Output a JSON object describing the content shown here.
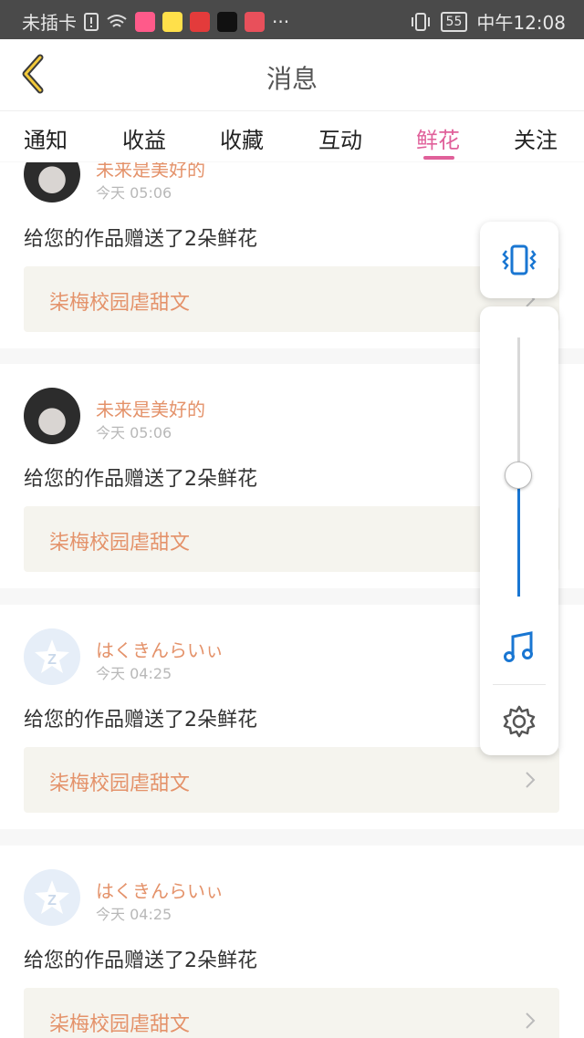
{
  "status_bar": {
    "carrier": "未插卡",
    "battery": "55",
    "time": "中午12:08",
    "more": "···",
    "icons": [
      "sim-alert-icon",
      "wifi-icon",
      "app-icon-1",
      "app-icon-2",
      "app-icon-3",
      "tiktok-icon",
      "reader-icon",
      "vibrate-icon"
    ]
  },
  "header": {
    "title": "消息"
  },
  "tabs": [
    {
      "label": "通知"
    },
    {
      "label": "收益"
    },
    {
      "label": "收藏"
    },
    {
      "label": "互动"
    },
    {
      "label": "鲜花",
      "active": true
    },
    {
      "label": "关注"
    }
  ],
  "messages": [
    {
      "username": "未来是美好的",
      "time": "今天 05:06",
      "text": "给您的作品赠送了2朵鲜花",
      "work": "柒梅校园虐甜文"
    },
    {
      "username": "未来是美好的",
      "time": "今天 05:06",
      "text": "给您的作品赠送了2朵鲜花",
      "work": "柒梅校园虐甜文"
    },
    {
      "username": "はくきんらいぃ",
      "time": "今天 04:25",
      "text": "给您的作品赠送了2朵鲜花",
      "work": "柒梅校园虐甜文"
    },
    {
      "username": "はくきんらいぃ",
      "time": "今天 04:25",
      "text": "给您的作品赠送了2朵鲜花",
      "work": "柒梅校园虐甜文"
    }
  ],
  "volume_panel": {
    "level": 0.5,
    "icons": [
      "vibrate-mode-icon",
      "music-note-icon",
      "settings-gear-icon"
    ]
  },
  "colors": {
    "accent": "#e0609a",
    "username": "#e4926a",
    "slider": "#1976d2"
  }
}
